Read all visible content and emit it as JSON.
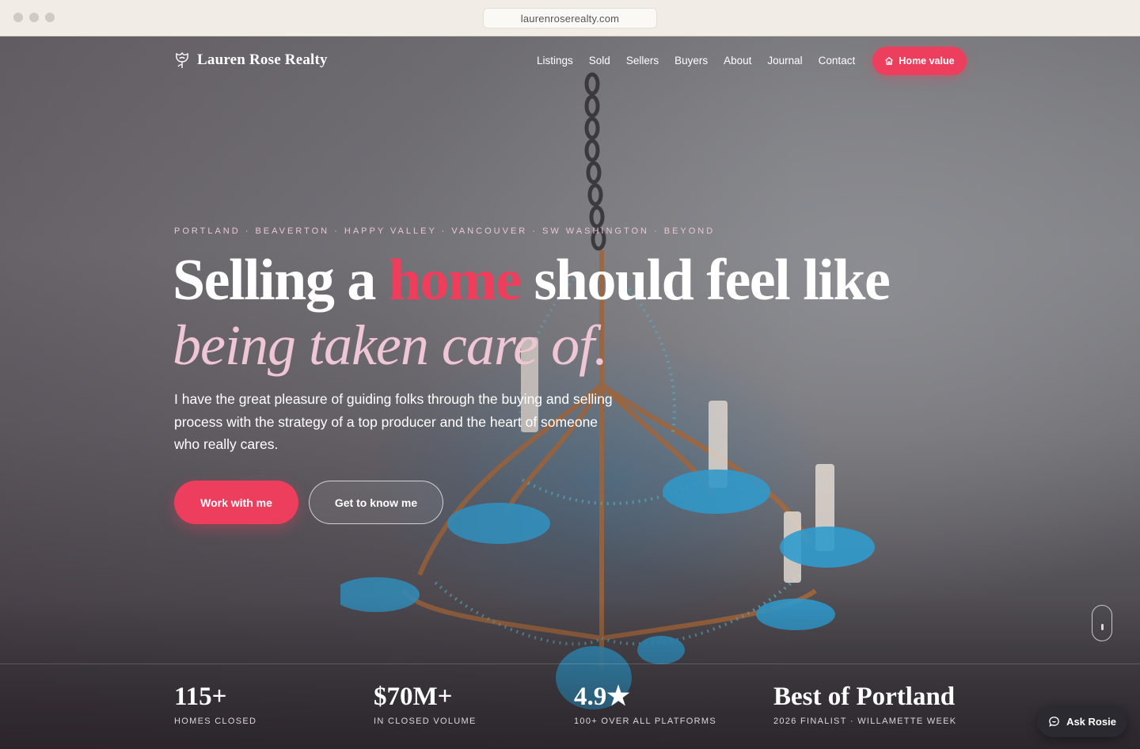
{
  "browser": {
    "url": "laurenroserealty.com"
  },
  "nav": {
    "brand": "Lauren Rose Realty",
    "brand_icon": "rose-icon",
    "links": [
      "Listings",
      "Sold",
      "Sellers",
      "Buyers",
      "About",
      "Journal",
      "Contact"
    ],
    "cta_label": "Home value",
    "cta_icon": "house-icon"
  },
  "hero": {
    "kicker": "PORTLAND · BEAVERTON · HAPPY VALLEY · VANCOUVER · SW WASHINGTON · BEYOND",
    "headline_pre": "Selling a ",
    "headline_accent": "home",
    "headline_post": " should feel like",
    "headline_italic": "being taken care of.",
    "lede": "I have the great pleasure of guiding folks through the buying and selling process with the strategy of a top producer and the heart of someone who really cares.",
    "primary_button": "Work with me",
    "secondary_button": "Get to know me"
  },
  "stats": [
    {
      "value": "115+",
      "label": "HOMES CLOSED"
    },
    {
      "value": "$70M+",
      "label": "IN CLOSED VOLUME"
    },
    {
      "value": "4.9★",
      "label": "100+ OVER ALL PLATFORMS"
    },
    {
      "value": "Best of Portland",
      "label": "2026 FINALIST · WILLAMETTE WEEK"
    }
  ],
  "chat": {
    "label": "Ask Rosie",
    "icon": "chat-bubble-icon"
  },
  "colors": {
    "accent": "#ee3e5e",
    "accent_soft": "#efc6d3",
    "chrome_bg": "#f1ede6",
    "chat_bg": "#2b2a30"
  }
}
